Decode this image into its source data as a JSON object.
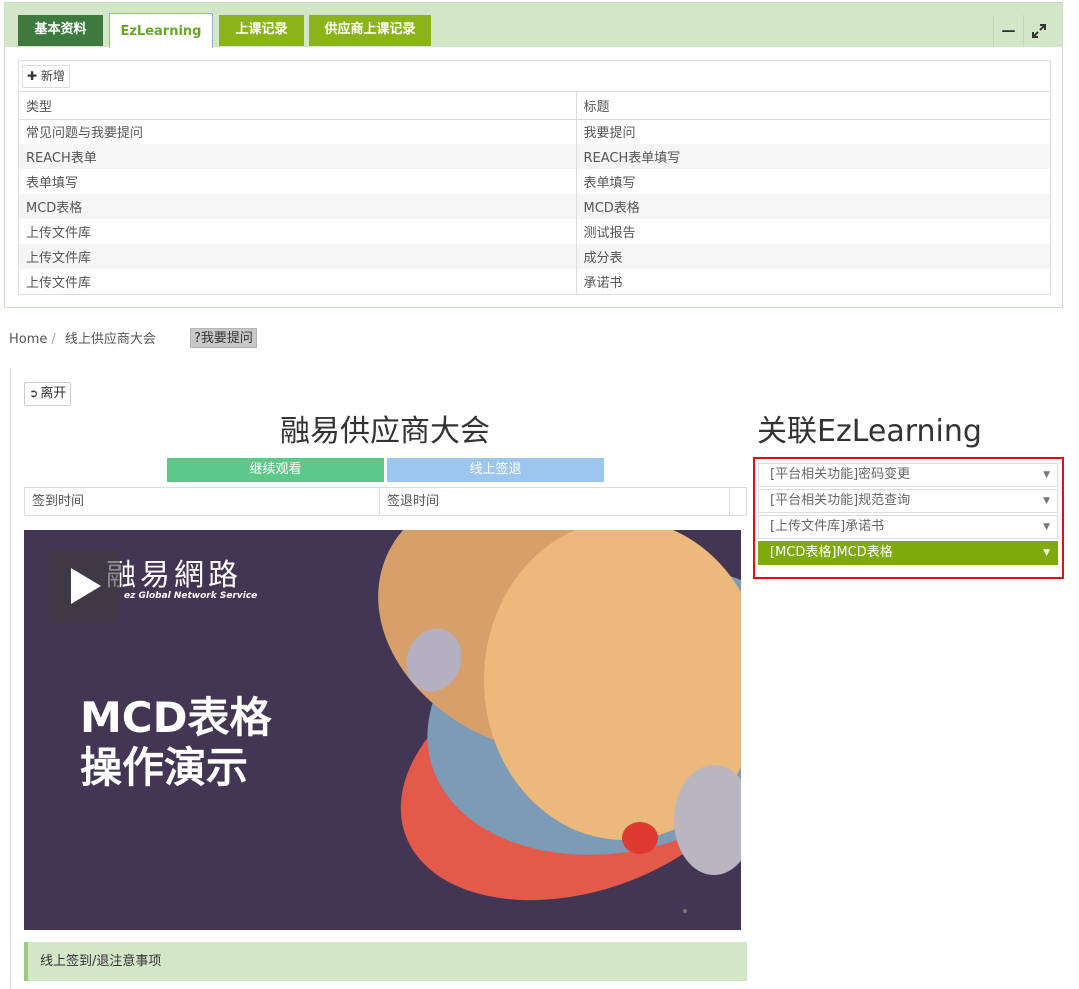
{
  "tabs": [
    {
      "label": "基本资料"
    },
    {
      "label": "EzLearning"
    },
    {
      "label": "上课记录"
    },
    {
      "label": "供应商上课记录"
    }
  ],
  "toolbar": {
    "add_label": "新增"
  },
  "table": {
    "headers": [
      "类型",
      "标题"
    ],
    "rows": [
      [
        "常见问题与我要提问",
        "我要提问"
      ],
      [
        "REACH表单",
        "REACH表单填写"
      ],
      [
        "表单填写",
        "表单填写"
      ],
      [
        "MCD表格",
        "MCD表格"
      ],
      [
        "上传文件库",
        "测试报告"
      ],
      [
        "上传文件库",
        "成分表"
      ],
      [
        "上传文件库",
        "承诺书"
      ]
    ]
  },
  "breadcrumb": {
    "home": "Home",
    "current": "线上供应商大会"
  },
  "ask_badge": "?我要提问",
  "leave_label": "离开",
  "main_title": "融易供应商大会",
  "continue_label": "继续观看",
  "signout_label": "线上签退",
  "sign_table": {
    "checkin": "签到时间",
    "checkout": "签退时间"
  },
  "video": {
    "brand": "融易網路",
    "brand_sub": "ez Global Network Service",
    "title_line1": "MCD表格",
    "title_line2": "操作演示"
  },
  "notice_label": "线上签到/退注意事项",
  "side": {
    "title": "关联EzLearning",
    "items": [
      {
        "label": "[平台相关功能]密码变更"
      },
      {
        "label": "[平台相关功能]规范查询"
      },
      {
        "label": "[上传文件库]承诺书"
      },
      {
        "label": "[MCD表格]MCD表格"
      }
    ]
  },
  "colors": {
    "tab_dark": "#3e7a3e",
    "tab_lime": "#8ab41a",
    "panel_bg": "#d4e6c8",
    "selected": "#7eaa0e",
    "highlight_border": "#dd1111"
  }
}
